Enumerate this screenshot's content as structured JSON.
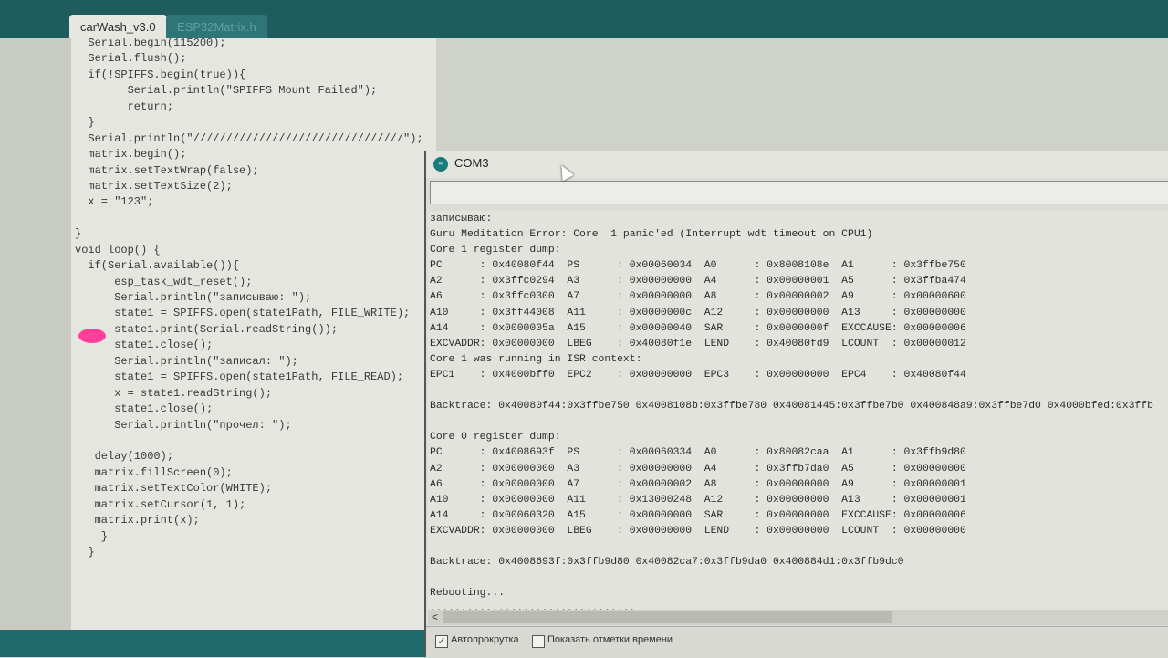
{
  "tabs": [
    {
      "label": "carWash_v3.0",
      "active": true
    },
    {
      "label": "ESP32Matrix.h",
      "active": false
    }
  ],
  "editor": {
    "lines": [
      "  Serial.begin(115200);",
      "  Serial.flush();",
      "  if(!SPIFFS.begin(true)){",
      "        Serial.println(\"SPIFFS Mount Failed\");",
      "        return;",
      "  }",
      "  Serial.println(\"////////////////////////////////\");",
      "  matrix.begin();",
      "  matrix.setTextWrap(false);",
      "  matrix.setTextSize(2);",
      "  x = \"123\";",
      "",
      "}",
      "void loop() {",
      "  if(Serial.available()){",
      "      esp_task_wdt_reset();",
      "      Serial.println(\"записываю: \");",
      "      state1 = SPIFFS.open(state1Path, FILE_WRITE);",
      "      state1.print(Serial.readString());",
      "      state1.close();",
      "      Serial.println(\"записал: \");",
      "      state1 = SPIFFS.open(state1Path, FILE_READ);",
      "      x = state1.readString();",
      "      state1.close();",
      "      Serial.println(\"прочел: \");",
      "",
      "   delay(1000);",
      "   matrix.fillScreen(0);",
      "   matrix.setTextColor(WHITE);",
      "   matrix.setCursor(1, 1);",
      "   matrix.print(x);",
      "    }",
      "  }"
    ]
  },
  "serial_monitor": {
    "title": "COM3",
    "input_value": "",
    "output_lines": [
      "записываю:",
      "Guru Meditation Error: Core  1 panic'ed (Interrupt wdt timeout on CPU1)",
      "Core 1 register dump:",
      "PC      : 0x40080f44  PS      : 0x00060034  A0      : 0x8008108e  A1      : 0x3ffbe750",
      "A2      : 0x3ffc0294  A3      : 0x00000000  A4      : 0x00000001  A5      : 0x3ffba474",
      "A6      : 0x3ffc0300  A7      : 0x00000000  A8      : 0x00000002  A9      : 0x00000600",
      "A10     : 0x3ff44008  A11     : 0x0000000c  A12     : 0x00000000  A13     : 0x00000000",
      "A14     : 0x0000005a  A15     : 0x00000040  SAR     : 0x0000000f  EXCCAUSE: 0x00000006",
      "EXCVADDR: 0x00000000  LBEG    : 0x40080f1e  LEND    : 0x40080fd9  LCOUNT  : 0x00000012",
      "Core 1 was running in ISR context:",
      "EPC1    : 0x4000bff0  EPC2    : 0x00000000  EPC3    : 0x00000000  EPC4    : 0x40080f44",
      "",
      "Backtrace: 0x40080f44:0x3ffbe750 0x4008108b:0x3ffbe780 0x40081445:0x3ffbe7b0 0x400848a9:0x3ffbe7d0 0x4000bfed:0x3ffb",
      "",
      "Core 0 register dump:",
      "PC      : 0x4008693f  PS      : 0x00060334  A0      : 0x80082caa  A1      : 0x3ffb9d80",
      "A2      : 0x00000000  A3      : 0x00000000  A4      : 0x3ffb7da0  A5      : 0x00000000",
      "A6      : 0x00000000  A7      : 0x00000002  A8      : 0x00000000  A9      : 0x00000001",
      "A10     : 0x00000000  A11     : 0x13000248  A12     : 0x00000000  A13     : 0x00000001",
      "A14     : 0x00060320  A15     : 0x00000000  SAR     : 0x00000000  EXCCAUSE: 0x00000006",
      "EXCVADDR: 0x00000000  LBEG    : 0x00000000  LEND    : 0x00000000  LCOUNT  : 0x00000000",
      "",
      "Backtrace: 0x4008693f:0x3ffb9d80 0x40082ca7:0x3ffb9da0 0x400884d1:0x3ffb9dc0",
      "",
      "Rebooting...",
      ",,,,,,,,,,,,,,,,,,,,,,,,,,,,,,,,,"
    ],
    "autoscroll": {
      "label": "Автопрокрутка",
      "checked": true
    },
    "timestamps": {
      "label": "Показать отметки времени",
      "checked": false
    },
    "scroll_left_glyph": "<",
    "logo_text": "∞"
  },
  "colors": {
    "accent": "#1f5c5e",
    "annotation_mark": "#ff3f9a"
  }
}
